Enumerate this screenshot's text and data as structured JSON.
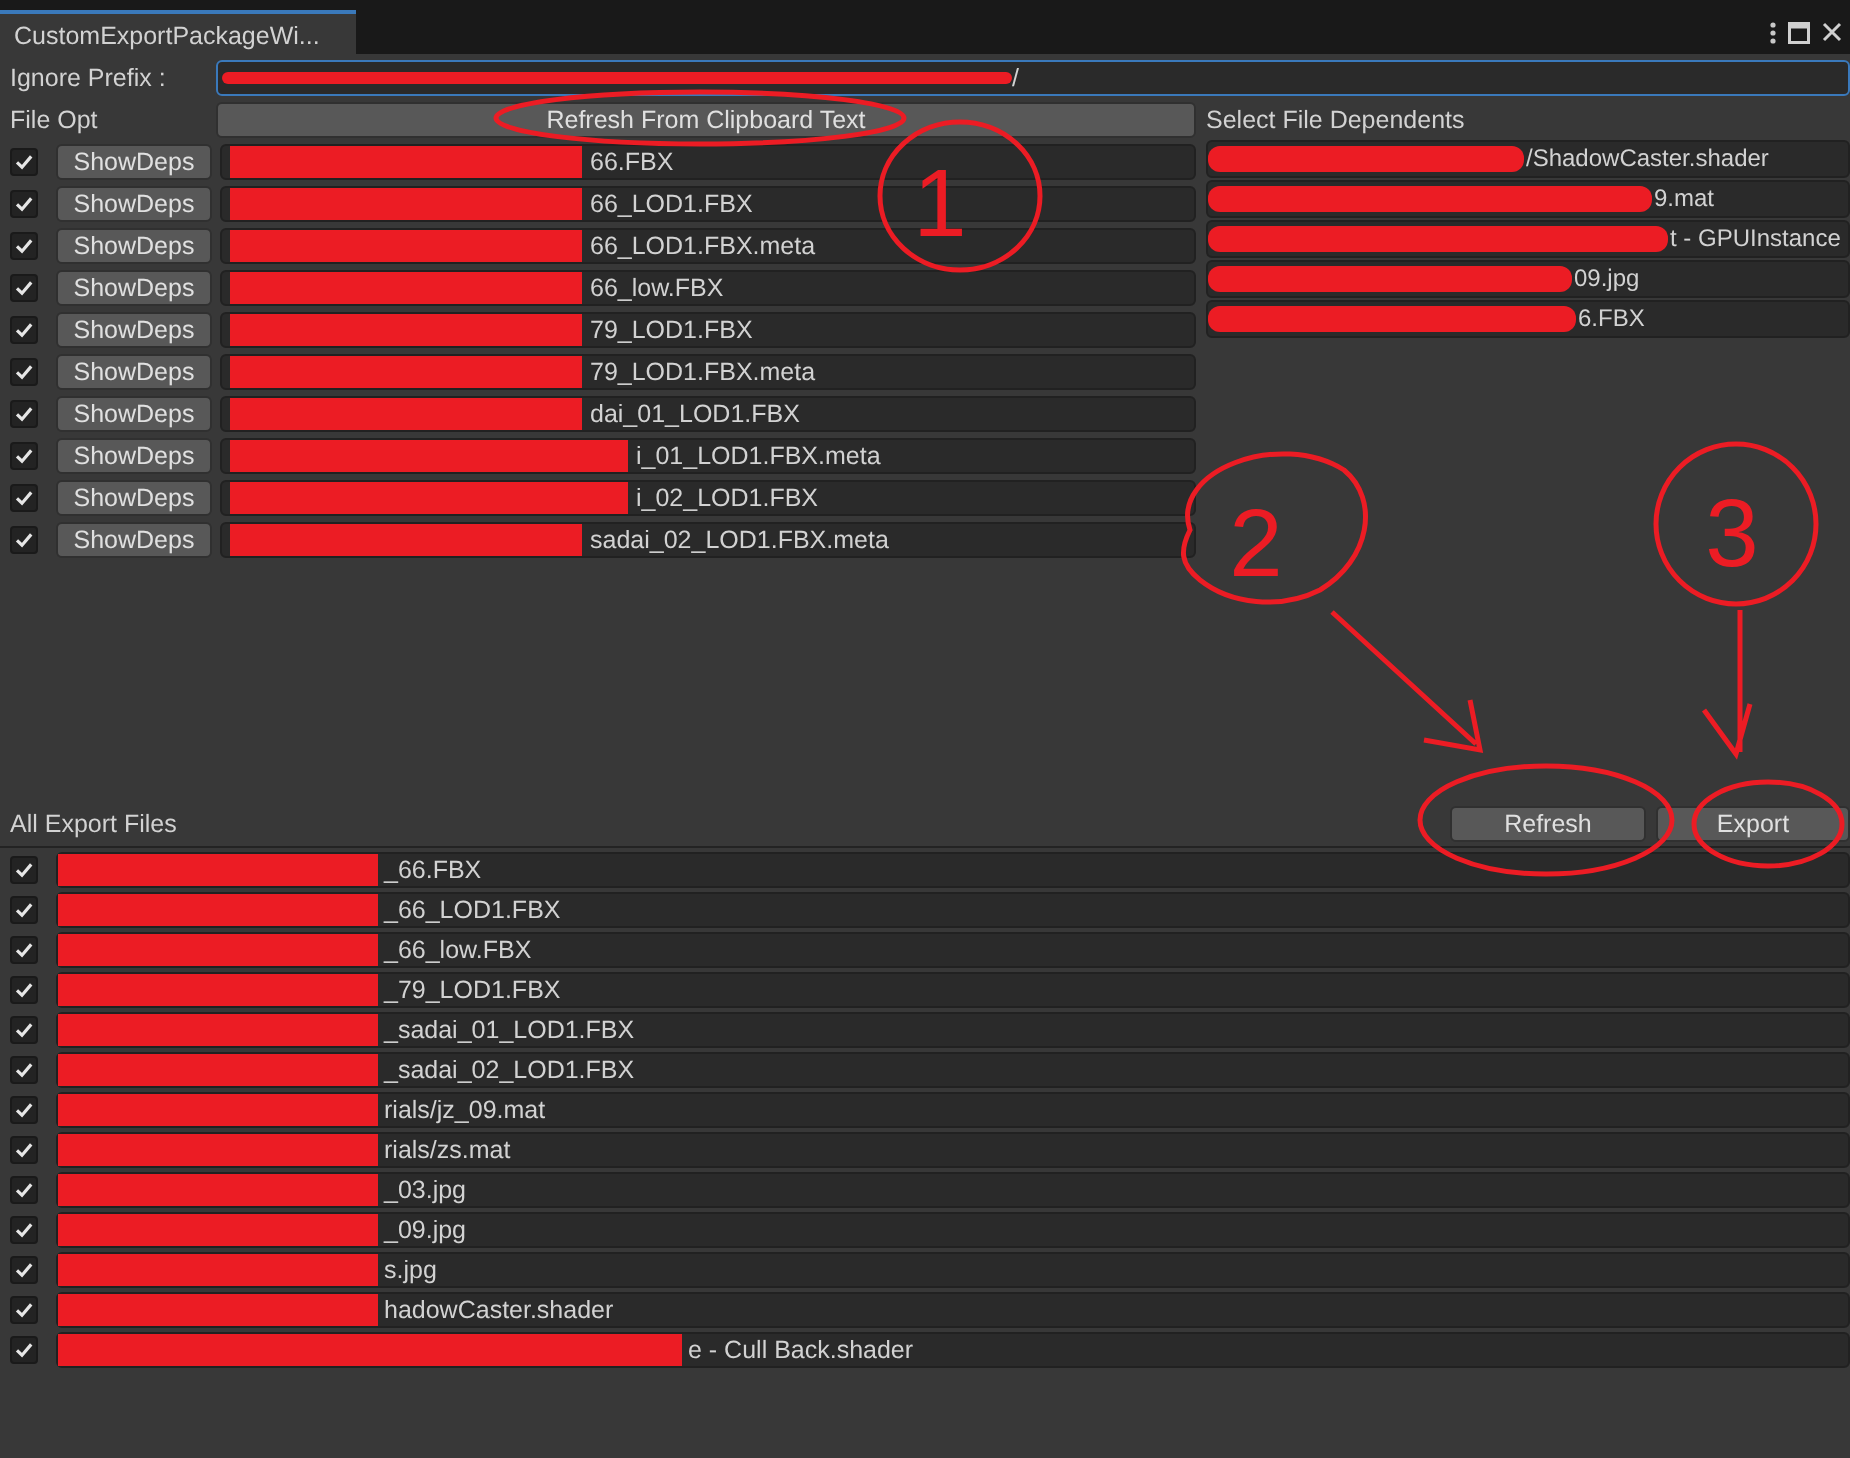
{
  "tab": {
    "label": "CustomExportPackageWi...",
    "selected": true
  },
  "ignore_prefix": {
    "label": "Ignore Prefix :",
    "value": "/"
  },
  "file_opt": {
    "label": "File Opt",
    "button": "Refresh From Clipboard Text"
  },
  "files": [
    {
      "checked": true,
      "button": "ShowDeps",
      "path": "66.FBX"
    },
    {
      "checked": true,
      "button": "ShowDeps",
      "path": "66_LOD1.FBX"
    },
    {
      "checked": true,
      "button": "ShowDeps",
      "path": "66_LOD1.FBX.meta"
    },
    {
      "checked": true,
      "button": "ShowDeps",
      "path": "66_low.FBX"
    },
    {
      "checked": true,
      "button": "ShowDeps",
      "path": "79_LOD1.FBX"
    },
    {
      "checked": true,
      "button": "ShowDeps",
      "path": "79_LOD1.FBX.meta"
    },
    {
      "checked": true,
      "button": "ShowDeps",
      "path": "dai_01_LOD1.FBX"
    },
    {
      "checked": true,
      "button": "ShowDeps",
      "path": "i_01_LOD1.FBX.meta"
    },
    {
      "checked": true,
      "button": "ShowDeps",
      "path": "i_02_LOD1.FBX"
    },
    {
      "checked": true,
      "button": "ShowDeps",
      "path": "sadai_02_LOD1.FBX.meta"
    }
  ],
  "dependents": {
    "title": "Select File Dependents",
    "items": [
      "/ShadowCaster.shader",
      "9.mat",
      "t - GPUInstance",
      "09.jpg",
      "6.FBX"
    ]
  },
  "export": {
    "title": "All Export Files",
    "buttons": [
      "Refresh",
      "Export"
    ],
    "files": [
      {
        "checked": true,
        "path": "_66.FBX"
      },
      {
        "checked": true,
        "path": "_66_LOD1.FBX"
      },
      {
        "checked": true,
        "path": "_66_low.FBX"
      },
      {
        "checked": true,
        "path": "_79_LOD1.FBX"
      },
      {
        "checked": true,
        "path": "_sadai_01_LOD1.FBX"
      },
      {
        "checked": true,
        "path": "_sadai_02_LOD1.FBX"
      },
      {
        "checked": true,
        "path": "rials/jz_09.mat"
      },
      {
        "checked": true,
        "path": "rials/zs.mat"
      },
      {
        "checked": true,
        "path": "_03.jpg"
      },
      {
        "checked": true,
        "path": "_09.jpg"
      },
      {
        "checked": true,
        "path": "s.jpg"
      },
      {
        "checked": true,
        "path": "hadowCaster.shader"
      },
      {
        "checked": true,
        "path": "e - Cull Back.shader"
      }
    ]
  },
  "annotations": [
    {
      "label": "1"
    },
    {
      "label": "2"
    },
    {
      "label": "3"
    }
  ]
}
